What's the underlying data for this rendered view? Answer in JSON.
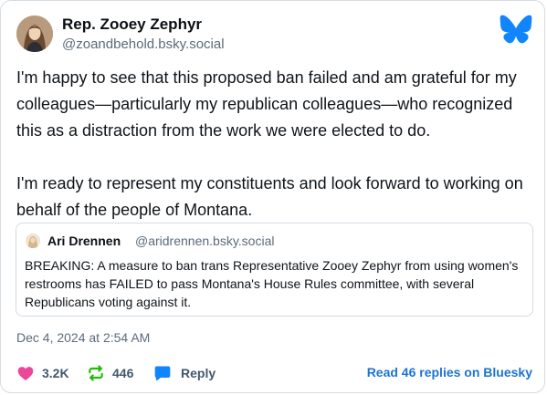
{
  "author": {
    "name": "Rep. Zooey Zephyr",
    "handle": "@zoandbehold.bsky.social",
    "avatar_icon": "profile-photo"
  },
  "brand": {
    "icon": "bluesky-butterfly-icon",
    "color": "#1185fe"
  },
  "post": {
    "paragraphs": [
      "I'm happy to see that this proposed ban failed and am grateful for my colleagues—particularly my republican colleagues—who recognized this as a distraction from the work we were elected to do.",
      "I'm ready to represent my constituents and look forward to working on behalf of the people of Montana."
    ]
  },
  "quote": {
    "name": "Ari Drennen",
    "handle": "@aridrennen.bsky.social",
    "text": "BREAKING: A measure to ban trans Representative Zooey Zephyr from using women's restrooms has FAILED to pass Montana's House Rules committee, with several Republicans voting against it."
  },
  "timestamp": "Dec 4, 2024 at 2:54 AM",
  "actions": {
    "likes": "3.2K",
    "reposts": "446",
    "reply_label": "Reply",
    "read_replies": "Read 46 replies on Bluesky"
  },
  "colors": {
    "like": "#ec4899",
    "repost": "#20bc07",
    "reply": "#1185fe",
    "link": "#1c74d4"
  }
}
